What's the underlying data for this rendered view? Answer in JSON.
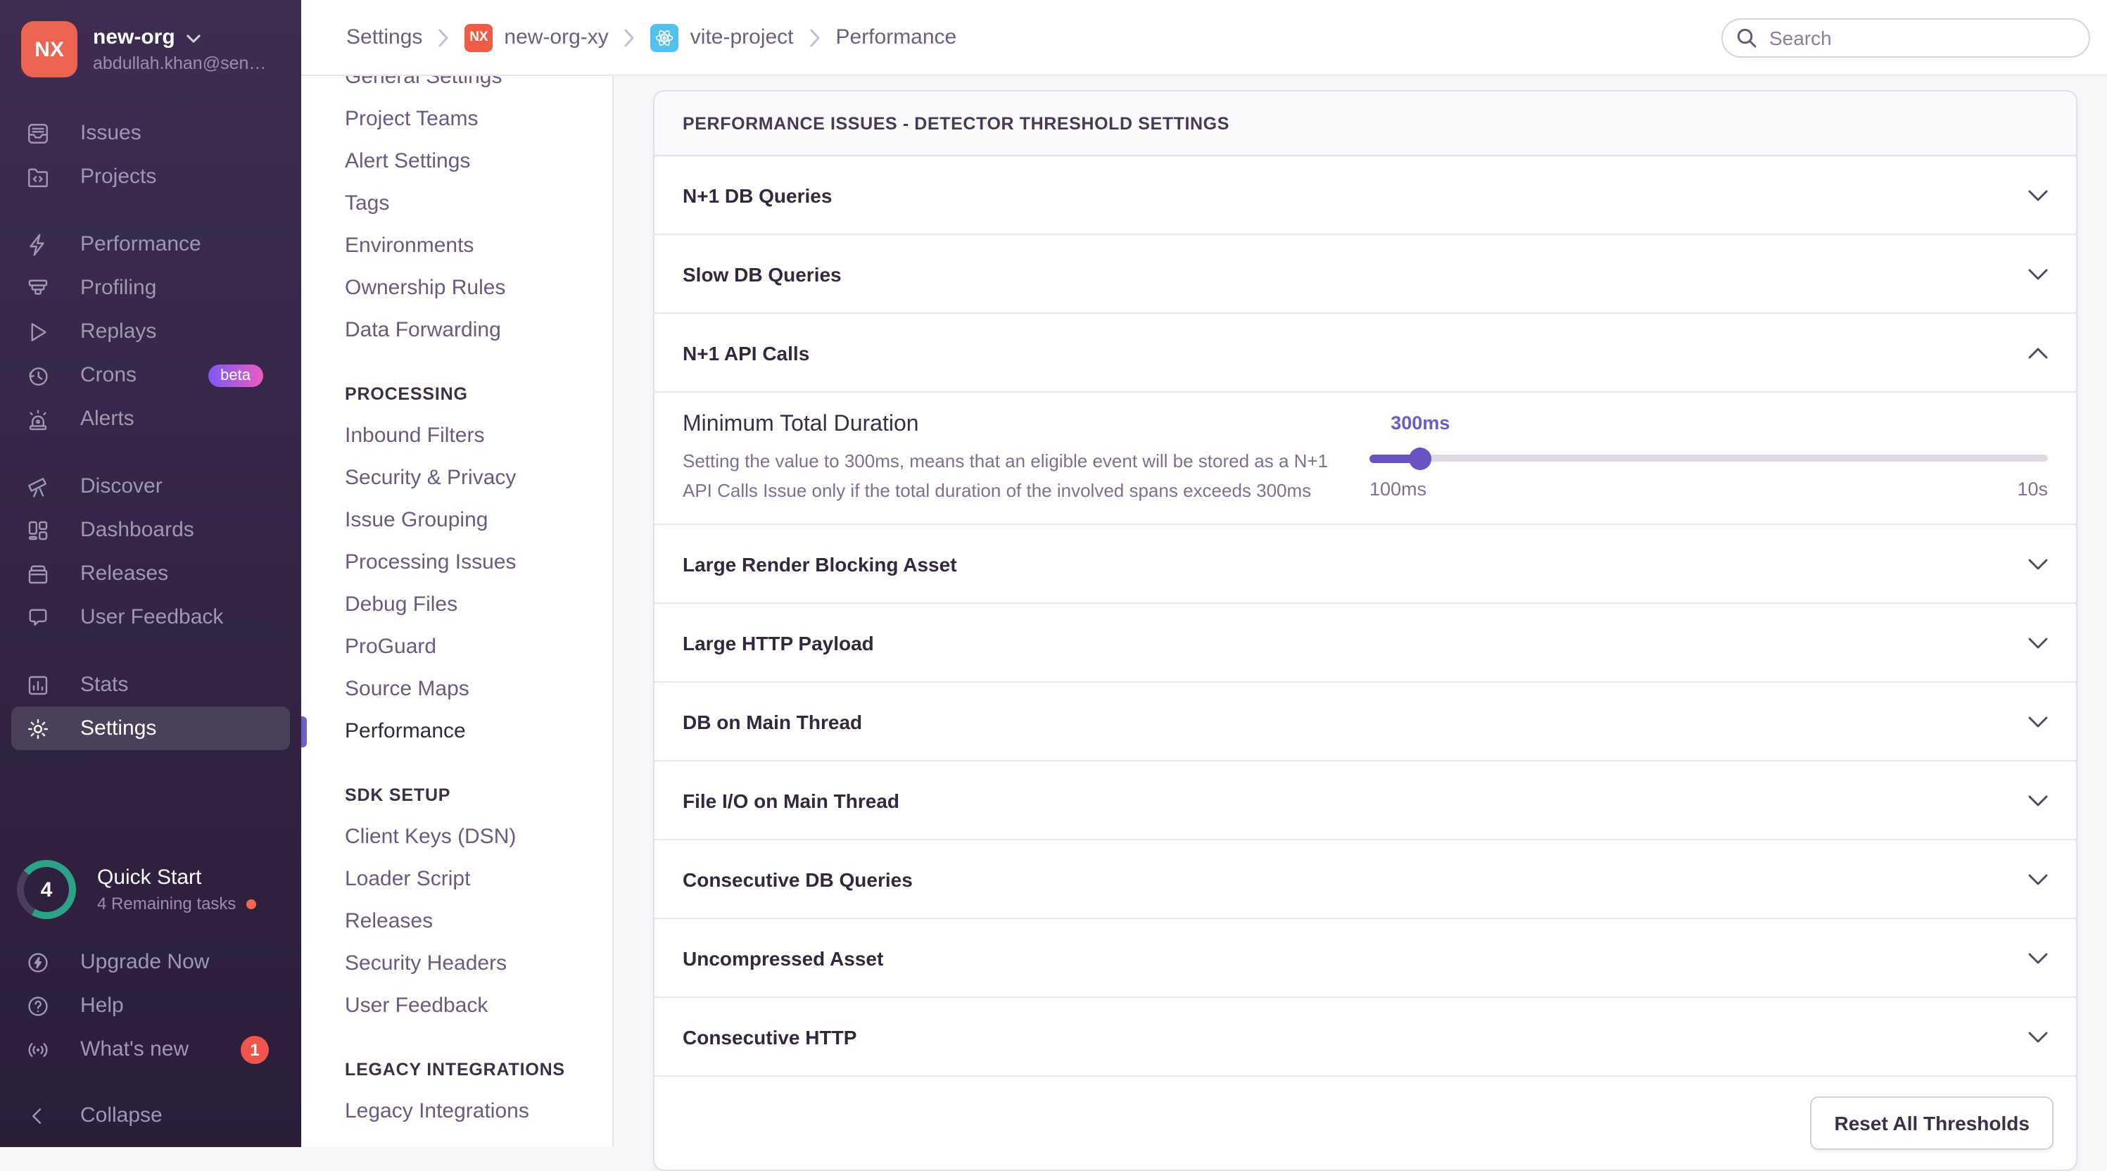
{
  "org": {
    "initials": "NX",
    "name": "new-org",
    "email": "abdullah.khan@sen…"
  },
  "topbar": {
    "search_placeholder": "Search",
    "breadcrumbs": [
      {
        "label": "Settings"
      },
      {
        "label": "new-org-xy",
        "chip": "NX"
      },
      {
        "label": "vite-project",
        "chip": "react-logo"
      },
      {
        "label": "Performance"
      }
    ]
  },
  "sidebar": {
    "groups": [
      {
        "items": [
          {
            "label": "Issues"
          },
          {
            "label": "Projects"
          }
        ]
      },
      {
        "items": [
          {
            "label": "Performance"
          },
          {
            "label": "Profiling"
          },
          {
            "label": "Replays"
          },
          {
            "label": "Crons",
            "badge": "beta"
          },
          {
            "label": "Alerts"
          }
        ]
      },
      {
        "items": [
          {
            "label": "Discover"
          },
          {
            "label": "Dashboards"
          },
          {
            "label": "Releases"
          },
          {
            "label": "User Feedback"
          }
        ]
      },
      {
        "items": [
          {
            "label": "Stats"
          },
          {
            "label": "Settings"
          }
        ]
      }
    ],
    "active_item": "Settings",
    "quick_start": {
      "progress_count": "4",
      "title": "Quick Start",
      "subtitle": "4 Remaining tasks"
    },
    "upgrade_label": "Upgrade Now",
    "help_label": "Help",
    "whats_new_label": "What's new",
    "whats_new_badge": "1",
    "collapse_label": "Collapse"
  },
  "settings_nav": {
    "active_item": "Performance",
    "sections": [
      {
        "items": [
          "General Settings",
          "Project Teams",
          "Alert Settings",
          "Tags",
          "Environments",
          "Ownership Rules",
          "Data Forwarding"
        ]
      },
      {
        "header": "PROCESSING",
        "items": [
          "Inbound Filters",
          "Security & Privacy",
          "Issue Grouping",
          "Processing Issues",
          "Debug Files",
          "ProGuard",
          "Source Maps",
          "Performance"
        ]
      },
      {
        "header": "SDK SETUP",
        "items": [
          "Client Keys (DSN)",
          "Loader Script",
          "Releases",
          "Security Headers",
          "User Feedback"
        ]
      },
      {
        "header": "LEGACY INTEGRATIONS",
        "items": [
          "Legacy Integrations"
        ]
      }
    ]
  },
  "panel": {
    "title": "PERFORMANCE ISSUES - DETECTOR THRESHOLD SETTINGS",
    "rows": [
      {
        "label": "N+1 DB Queries",
        "state": "collapsed"
      },
      {
        "label": "Slow DB Queries",
        "state": "collapsed"
      },
      {
        "label": "N+1 API Calls",
        "state": "expanded"
      },
      {
        "label": "Large Render Blocking Asset",
        "state": "collapsed"
      },
      {
        "label": "Large HTTP Payload",
        "state": "collapsed"
      },
      {
        "label": "DB on Main Thread",
        "state": "collapsed"
      },
      {
        "label": "File I/O on Main Thread",
        "state": "collapsed"
      },
      {
        "label": "Consecutive DB Queries",
        "state": "collapsed"
      },
      {
        "label": "Uncompressed Asset",
        "state": "collapsed"
      },
      {
        "label": "Consecutive HTTP",
        "state": "collapsed"
      }
    ],
    "expanded_detail": {
      "setting_label": "Minimum Total Duration",
      "setting_description": "Setting the value to 300ms, means that an eligible event will be stored as a N+1 API Calls Issue only if the total duration of the involved spans exceeds 300ms",
      "slider": {
        "value_label": "300ms",
        "min_label": "100ms",
        "max_label": "10s",
        "position_pct": 7.5
      }
    },
    "reset_button_label": "Reset All Thresholds"
  },
  "colors": {
    "accent_purple": "#6a52c3",
    "active_nav_bar": "#6c5fc7",
    "org_avatar_orange": "#ec6352",
    "react_chip_blue": "#53c1ee",
    "beta_badge_gradient_start": "#7d59f0",
    "beta_badge_gradient_end": "#e95cc1",
    "notification_red": "#f0554d",
    "quickstart_teal": "#2ca388",
    "sidebar_top": "#3e2d51",
    "sidebar_bottom": "#2c1d39"
  }
}
